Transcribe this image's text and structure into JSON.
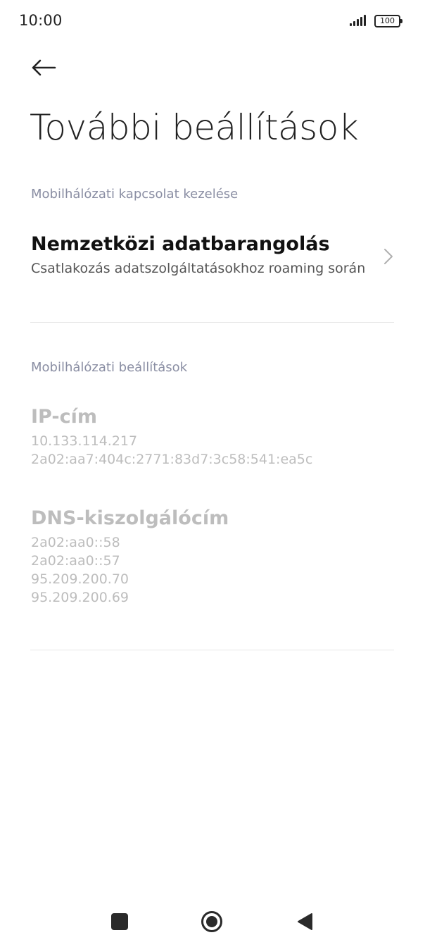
{
  "status_bar": {
    "time": "10:00",
    "battery": "100"
  },
  "header": {
    "back_icon": "arrow-left-icon",
    "title": "További beállítások"
  },
  "sections": {
    "connection": {
      "header": "Mobilhálózati kapcsolat kezelése",
      "roaming": {
        "title": "Nemzetközi adatbarangolás",
        "subtitle": "Csatlakozás adatszolgáltatásokhoz roaming során",
        "icon": "chevron-right-icon"
      }
    },
    "network_settings": {
      "header": "Mobilhálózati beállítások",
      "ip": {
        "title": "IP-cím",
        "values": [
          "10.133.114.217",
          "2a02:aa7:404c:2771:83d7:3c58:541:ea5c"
        ]
      },
      "dns": {
        "title": "DNS-kiszolgálócím",
        "values": [
          "2a02:aa0::58",
          "2a02:aa0::57",
          "95.209.200.70",
          "95.209.200.69"
        ]
      }
    }
  },
  "nav_bar": {
    "recents_icon": "square-icon",
    "home_icon": "circle-home-icon",
    "back_icon": "triangle-back-icon"
  },
  "colors": {
    "section_header": "#8a8ea3",
    "disabled_text": "#bdbdbd",
    "divider": "#e6e6e6"
  }
}
